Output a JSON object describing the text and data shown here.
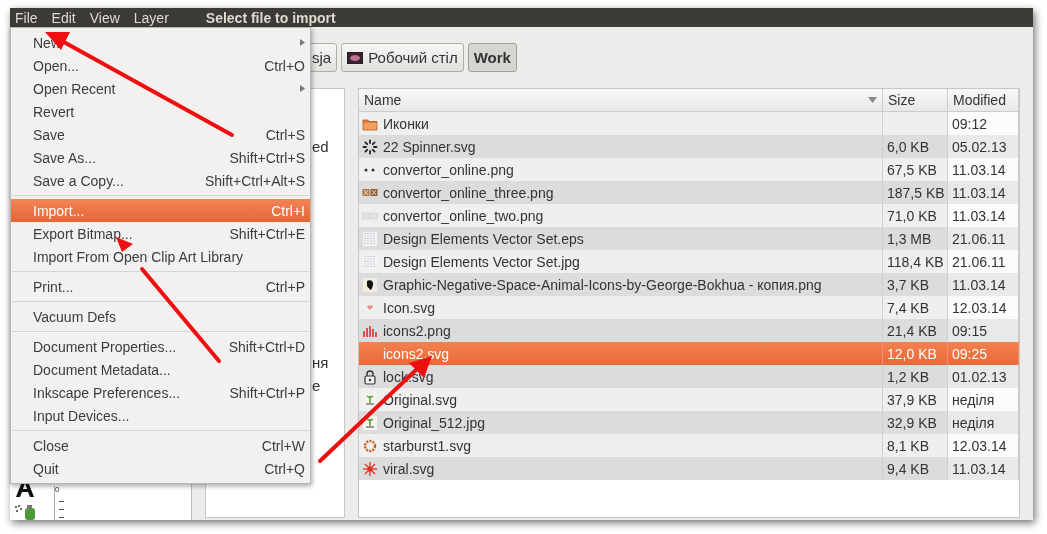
{
  "menubar": [
    "File",
    "Edit",
    "View",
    "Layer"
  ],
  "dialog_title": "Select file to import",
  "toolbox": {
    "ruler_label": "0"
  },
  "path_buttons": [
    {
      "label": "sja",
      "kind": "plain",
      "selected": false
    },
    {
      "label": "Робочий стіл",
      "kind": "desktop",
      "selected": false
    },
    {
      "label": "Work",
      "kind": "plain",
      "selected": true
    }
  ],
  "places": [
    "ed",
    "ня",
    "e"
  ],
  "file_list": {
    "columns": [
      {
        "label": "Name",
        "sorted": true
      },
      {
        "label": "Size",
        "sorted": false
      },
      {
        "label": "Modified",
        "sorted": false
      }
    ],
    "rows": [
      {
        "kind": "folder",
        "name": "Иконки",
        "modified": "09:12",
        "selected": false
      },
      {
        "kind": "spinner",
        "name": "22 Spinner.svg",
        "size": "6,0 KB",
        "modified": "05.02.13",
        "selected": false
      },
      {
        "kind": "dots",
        "name": "convertor_online.png",
        "size": "67,5 KB",
        "modified": "11.03.14",
        "selected": false
      },
      {
        "kind": "tiles",
        "name": "convertor_online_three.png",
        "size": "187,5 KB",
        "modified": "11.03.14",
        "selected": false
      },
      {
        "kind": "faint",
        "name": "convertor_online_two.png",
        "size": "71,0 KB",
        "modified": "11.03.14",
        "selected": false
      },
      {
        "kind": "grid",
        "name": "Design Elements Vector Set.eps",
        "size": "1,3 MB",
        "modified": "21.06.11",
        "selected": false
      },
      {
        "kind": "grid",
        "name": "Design Elements Vector Set.jpg",
        "size": "118,4 KB",
        "modified": "21.06.11",
        "selected": false
      },
      {
        "kind": "animal",
        "name": "Graphic-Negative-Space-Animal-Icons-by-George-Bokhua - копия.png",
        "size": "3,7 KB",
        "modified": "11.03.14",
        "selected": false
      },
      {
        "kind": "heart",
        "name": "Icon.svg",
        "size": "7,4 KB",
        "modified": "12.03.14",
        "selected": false
      },
      {
        "kind": "bars",
        "name": "icons2.png",
        "size": "21,4 KB",
        "modified": "09:15",
        "selected": false
      },
      {
        "kind": "none",
        "name": "icons2.svg",
        "size": "12,0 KB",
        "modified": "09:25",
        "selected": true
      },
      {
        "kind": "lock",
        "name": "lock.svg",
        "size": "1,2 KB",
        "modified": "01.02.13",
        "selected": false
      },
      {
        "kind": "plant",
        "name": "Original.svg",
        "size": "37,9 KB",
        "modified": "неділя",
        "selected": false
      },
      {
        "kind": "plant",
        "name": "Original_512.jpg",
        "size": "32,9 KB",
        "modified": "неділя",
        "selected": false
      },
      {
        "kind": "starburst",
        "name": "starburst1.svg",
        "size": "8,1 KB",
        "modified": "12.03.14",
        "selected": false
      },
      {
        "kind": "viral",
        "name": "viral.svg",
        "size": "9,4 KB",
        "modified": "11.03.14",
        "selected": false
      }
    ]
  },
  "file_menu": {
    "items": [
      {
        "kind": "item",
        "label": "New",
        "submenu": true,
        "selected": false
      },
      {
        "kind": "item",
        "label": "Open...",
        "shortcut": "Ctrl+O",
        "submenu": false,
        "selected": false
      },
      {
        "kind": "item",
        "label": "Open Recent",
        "submenu": true,
        "selected": false
      },
      {
        "kind": "item",
        "label": "Revert",
        "submenu": false,
        "selected": false
      },
      {
        "kind": "item",
        "label": "Save",
        "shortcut": "Ctrl+S",
        "submenu": false,
        "selected": false
      },
      {
        "kind": "item",
        "label": "Save As...",
        "shortcut": "Shift+Ctrl+S",
        "submenu": false,
        "selected": false
      },
      {
        "kind": "item",
        "label": "Save a Copy...",
        "shortcut": "Shift+Ctrl+Alt+S",
        "submenu": false,
        "selected": false
      },
      {
        "kind": "separator"
      },
      {
        "kind": "item",
        "label": "Import...",
        "shortcut": "Ctrl+I",
        "submenu": false,
        "selected": true
      },
      {
        "kind": "item",
        "label": "Export Bitmap...",
        "shortcut": "Shift+Ctrl+E",
        "submenu": false,
        "selected": false
      },
      {
        "kind": "item",
        "label": "Import From Open Clip Art Library",
        "submenu": false,
        "selected": false
      },
      {
        "kind": "separator"
      },
      {
        "kind": "item",
        "label": "Print...",
        "shortcut": "Ctrl+P",
        "submenu": false,
        "selected": false
      },
      {
        "kind": "separator"
      },
      {
        "kind": "item",
        "label": "Vacuum Defs",
        "submenu": false,
        "selected": false
      },
      {
        "kind": "separator"
      },
      {
        "kind": "item",
        "label": "Document Properties...",
        "shortcut": "Shift+Ctrl+D",
        "submenu": false,
        "selected": false
      },
      {
        "kind": "item",
        "label": "Document Metadata...",
        "submenu": false,
        "selected": false
      },
      {
        "kind": "item",
        "label": "Inkscape Preferences...",
        "shortcut": "Shift+Ctrl+P",
        "submenu": false,
        "selected": false
      },
      {
        "kind": "item",
        "label": "Input Devices...",
        "submenu": false,
        "selected": false
      },
      {
        "kind": "separator"
      },
      {
        "kind": "item",
        "label": "Close",
        "shortcut": "Ctrl+W",
        "submenu": false,
        "selected": false
      },
      {
        "kind": "item",
        "label": "Quit",
        "shortcut": "Ctrl+Q",
        "submenu": false,
        "selected": false
      }
    ]
  }
}
